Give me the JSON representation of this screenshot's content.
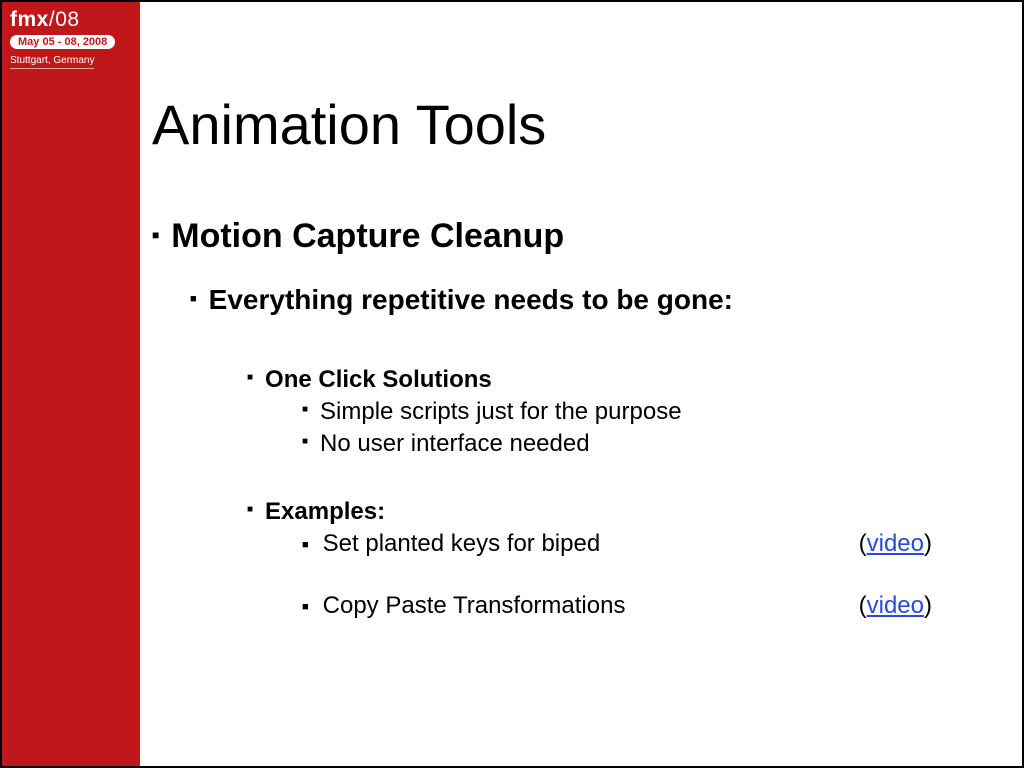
{
  "logo": {
    "brand": "fmx",
    "year": "/08",
    "date": "May 05 - 08, 2008",
    "location": "Stuttgart, Germany"
  },
  "title": "Animation Tools",
  "lvl1": "Motion Capture Cleanup",
  "lvl2": "Everything repetitive needs to be gone:",
  "sections": [
    {
      "heading": "One Click Solutions",
      "items": [
        "Simple scripts just for the purpose",
        "No user interface needed"
      ]
    },
    {
      "heading": "Examples:",
      "examples": [
        {
          "label": "Set planted keys for biped",
          "link": "video"
        },
        {
          "label": "Copy Paste Transformations",
          "link": "video"
        }
      ]
    }
  ]
}
